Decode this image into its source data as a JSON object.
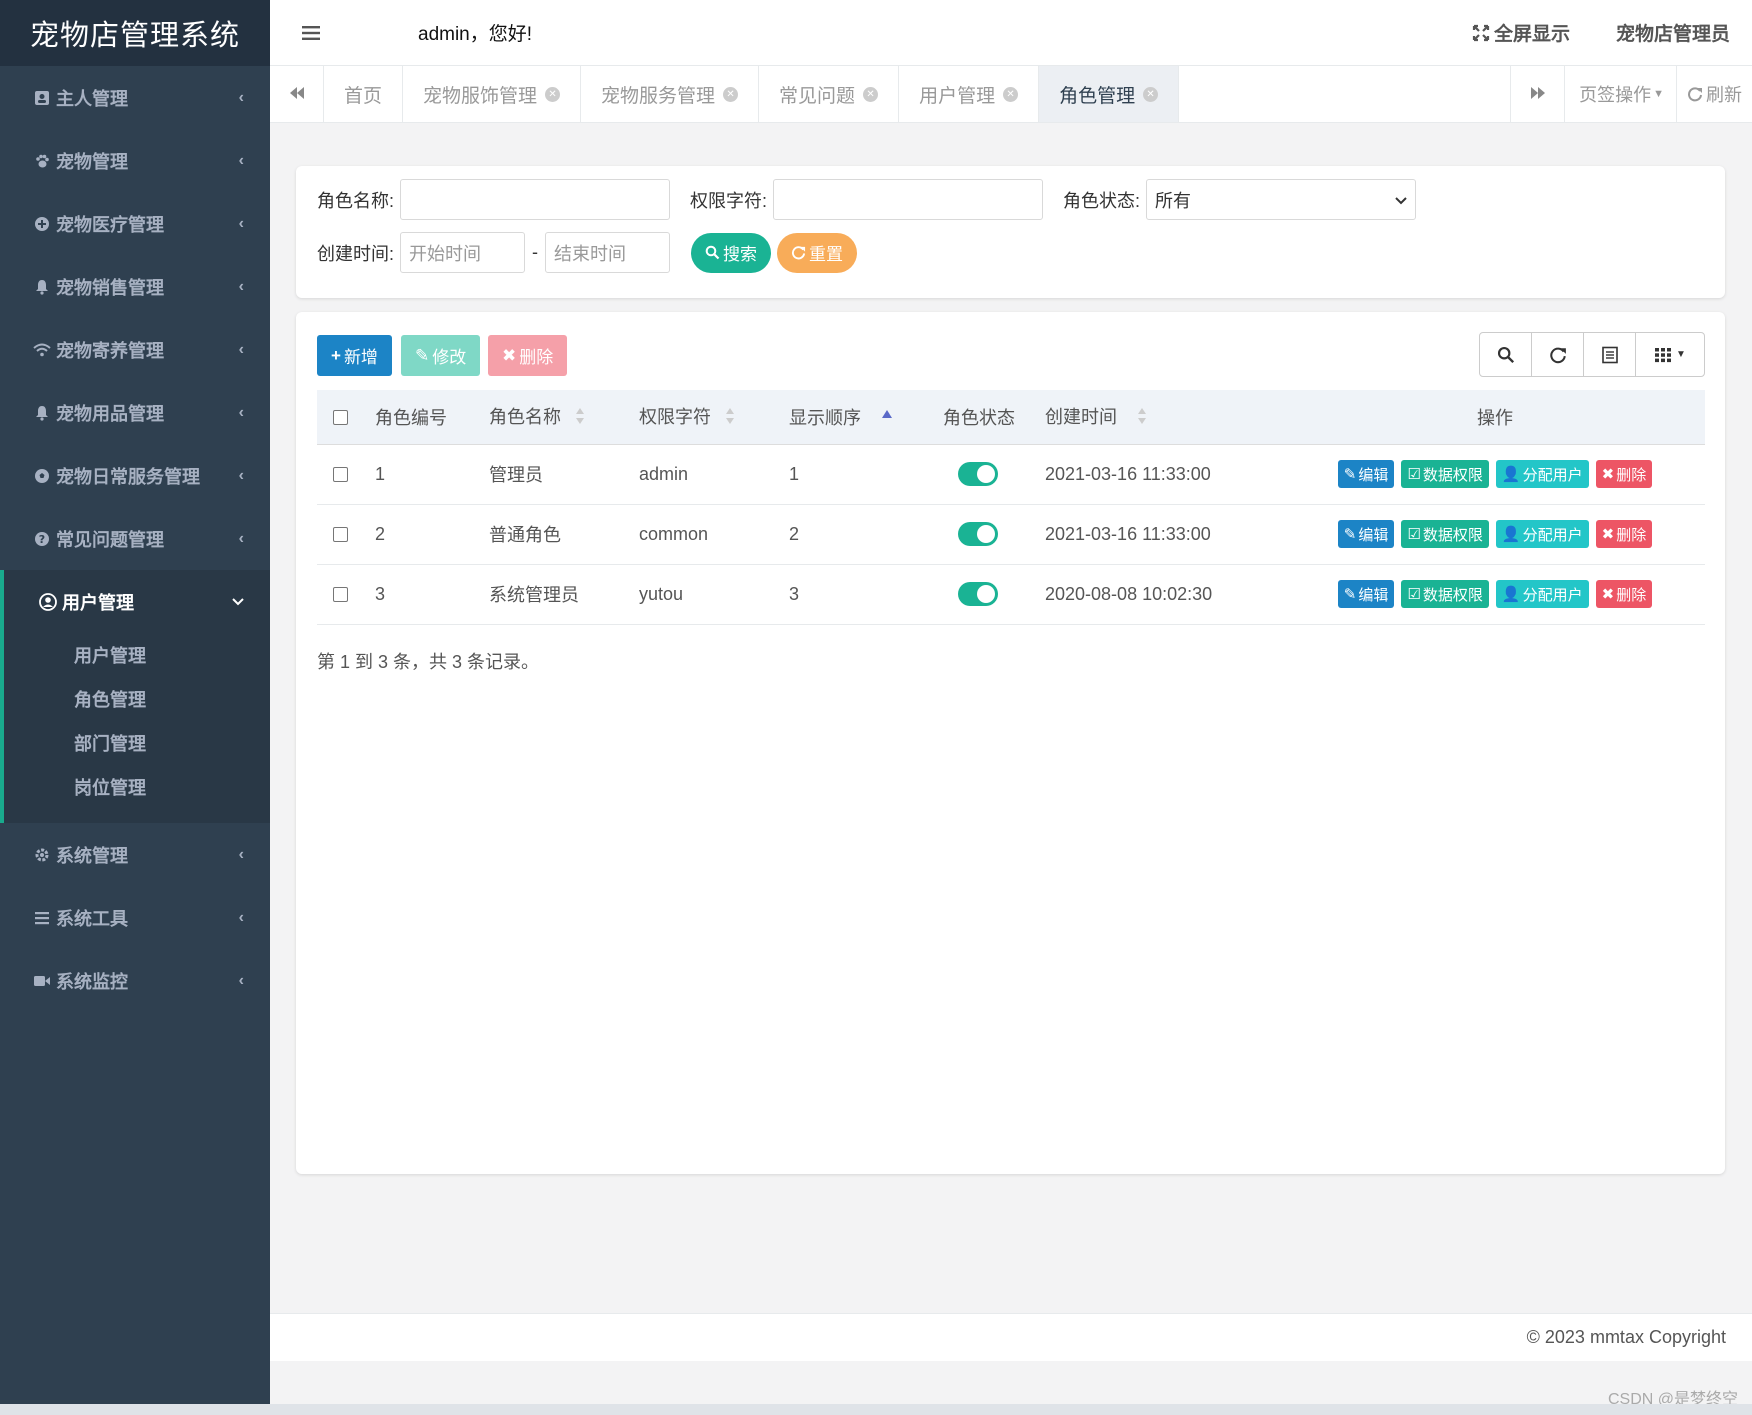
{
  "app": {
    "title": "宠物店管理系统"
  },
  "header": {
    "greeting": "admin，您好!",
    "fullscreen_label": "全屏显示",
    "user_label": "宠物店管理员"
  },
  "sidebar": {
    "items": [
      {
        "label": "主人管理",
        "icon": "address-card-icon"
      },
      {
        "label": "宠物管理",
        "icon": "paw-icon"
      },
      {
        "label": "宠物医疗管理",
        "icon": "plus-circle-icon"
      },
      {
        "label": "宠物销售管理",
        "icon": "bell-icon"
      },
      {
        "label": "宠物寄养管理",
        "icon": "wifi-icon"
      },
      {
        "label": "宠物用品管理",
        "icon": "bell-icon"
      },
      {
        "label": "宠物日常服务管理",
        "icon": "soccer-ball-icon"
      },
      {
        "label": "常见问题管理",
        "icon": "question-circle-icon"
      }
    ],
    "open_group": {
      "label": "用户管理",
      "icon": "user-circle-icon",
      "children": [
        "用户管理",
        "角色管理",
        "部门管理",
        "岗位管理"
      ]
    },
    "bottom_items": [
      {
        "label": "系统管理",
        "icon": "gear-icon"
      },
      {
        "label": "系统工具",
        "icon": "bars-icon"
      },
      {
        "label": "系统监控",
        "icon": "video-camera-icon"
      }
    ]
  },
  "tabs": {
    "items": [
      "首页",
      "宠物服饰管理",
      "宠物服务管理",
      "常见问题",
      "用户管理",
      "角色管理"
    ],
    "active_index": 5,
    "tab_ops_label": "页签操作",
    "refresh_label": "刷新"
  },
  "search": {
    "role_name_label": "角色名称:",
    "role_key_label": "权限字符:",
    "status_label": "角色状态:",
    "status_value": "所有",
    "created_label": "创建时间:",
    "start_placeholder": "开始时间",
    "separator": "-",
    "end_placeholder": "结束时间",
    "search_button": "搜索",
    "reset_button": "重置"
  },
  "toolbar": {
    "add_label": "新增",
    "edit_label": "修改",
    "delete_label": "删除"
  },
  "table": {
    "columns": [
      "角色编号",
      "角色名称",
      "权限字符",
      "显示顺序",
      "角色状态",
      "创建时间",
      "操作"
    ],
    "rows": [
      {
        "id": "1",
        "name": "管理员",
        "key": "admin",
        "order": "1",
        "enabled": true,
        "created": "2021-03-16 11:33:00"
      },
      {
        "id": "2",
        "name": "普通角色",
        "key": "common",
        "order": "2",
        "enabled": true,
        "created": "2021-03-16 11:33:00"
      },
      {
        "id": "3",
        "name": "系统管理员",
        "key": "yutou",
        "order": "3",
        "enabled": true,
        "created": "2020-08-08 10:02:30"
      }
    ],
    "row_actions": {
      "edit": "编辑",
      "data_scope": "数据权限",
      "assign_user": "分配用户",
      "delete": "删除"
    },
    "pager_info": "第 1 到 3 条，共 3 条记录。"
  },
  "footer": {
    "copyright": "© 2023 mmtax Copyright"
  },
  "watermark": "CSDN @是梦终空",
  "colors": {
    "sidebar_bg": "#2f4050",
    "primary": "#1c84c6",
    "success": "#1ab394",
    "info": "#23c6c8",
    "warning": "#f8ac59",
    "danger": "#ed5565"
  }
}
